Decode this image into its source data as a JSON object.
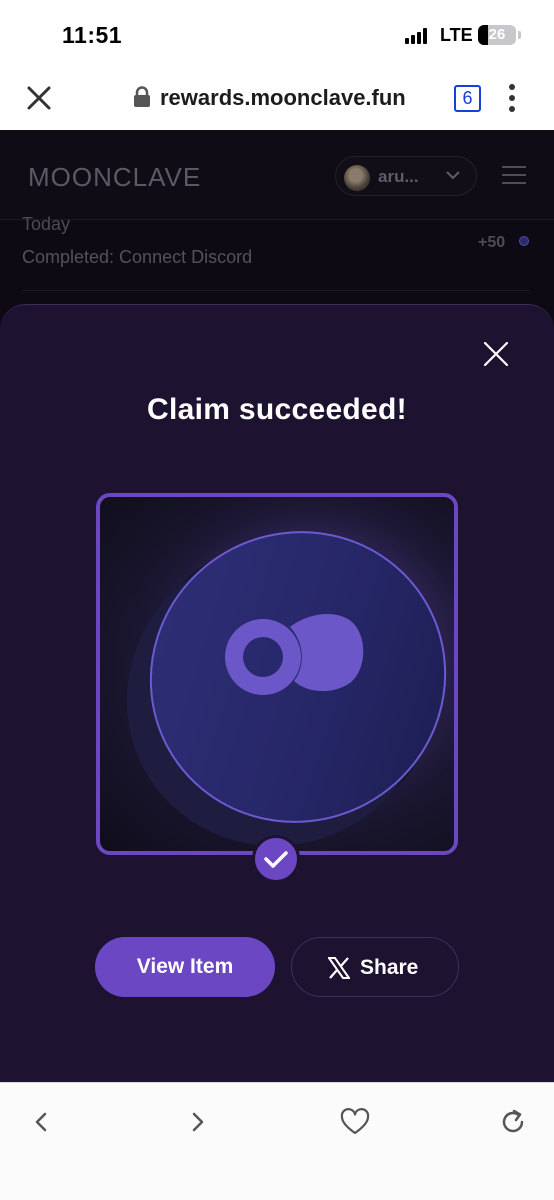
{
  "status_bar": {
    "time": "11:51",
    "network": "LTE",
    "battery": "26",
    "battery_level": 0.26
  },
  "browser": {
    "url": "rewards.moonclave.fun",
    "tab_count": "6"
  },
  "site": {
    "logo": "MOONCLAVE",
    "user_name": "aru...",
    "activity": {
      "date": "Today",
      "description": "Completed: Connect Discord",
      "points": "+50"
    }
  },
  "modal": {
    "title": "Claim succeeded!",
    "view_item_label": "View Item",
    "share_label": "Share"
  },
  "colors": {
    "accent": "#6b47c4",
    "modal_bg": "#1d1230",
    "site_bg": "#0d0a13"
  },
  "icons": {
    "close": "close-icon",
    "lock": "lock-icon",
    "menu": "more-vertical-icon",
    "chevron": "chevron-down-icon",
    "hamburger": "hamburger-menu-icon",
    "check": "check-icon",
    "x_logo": "x-logo-icon",
    "back": "chevron-left-icon",
    "forward": "chevron-right-icon",
    "favorite": "heart-icon",
    "reload": "reload-icon"
  }
}
